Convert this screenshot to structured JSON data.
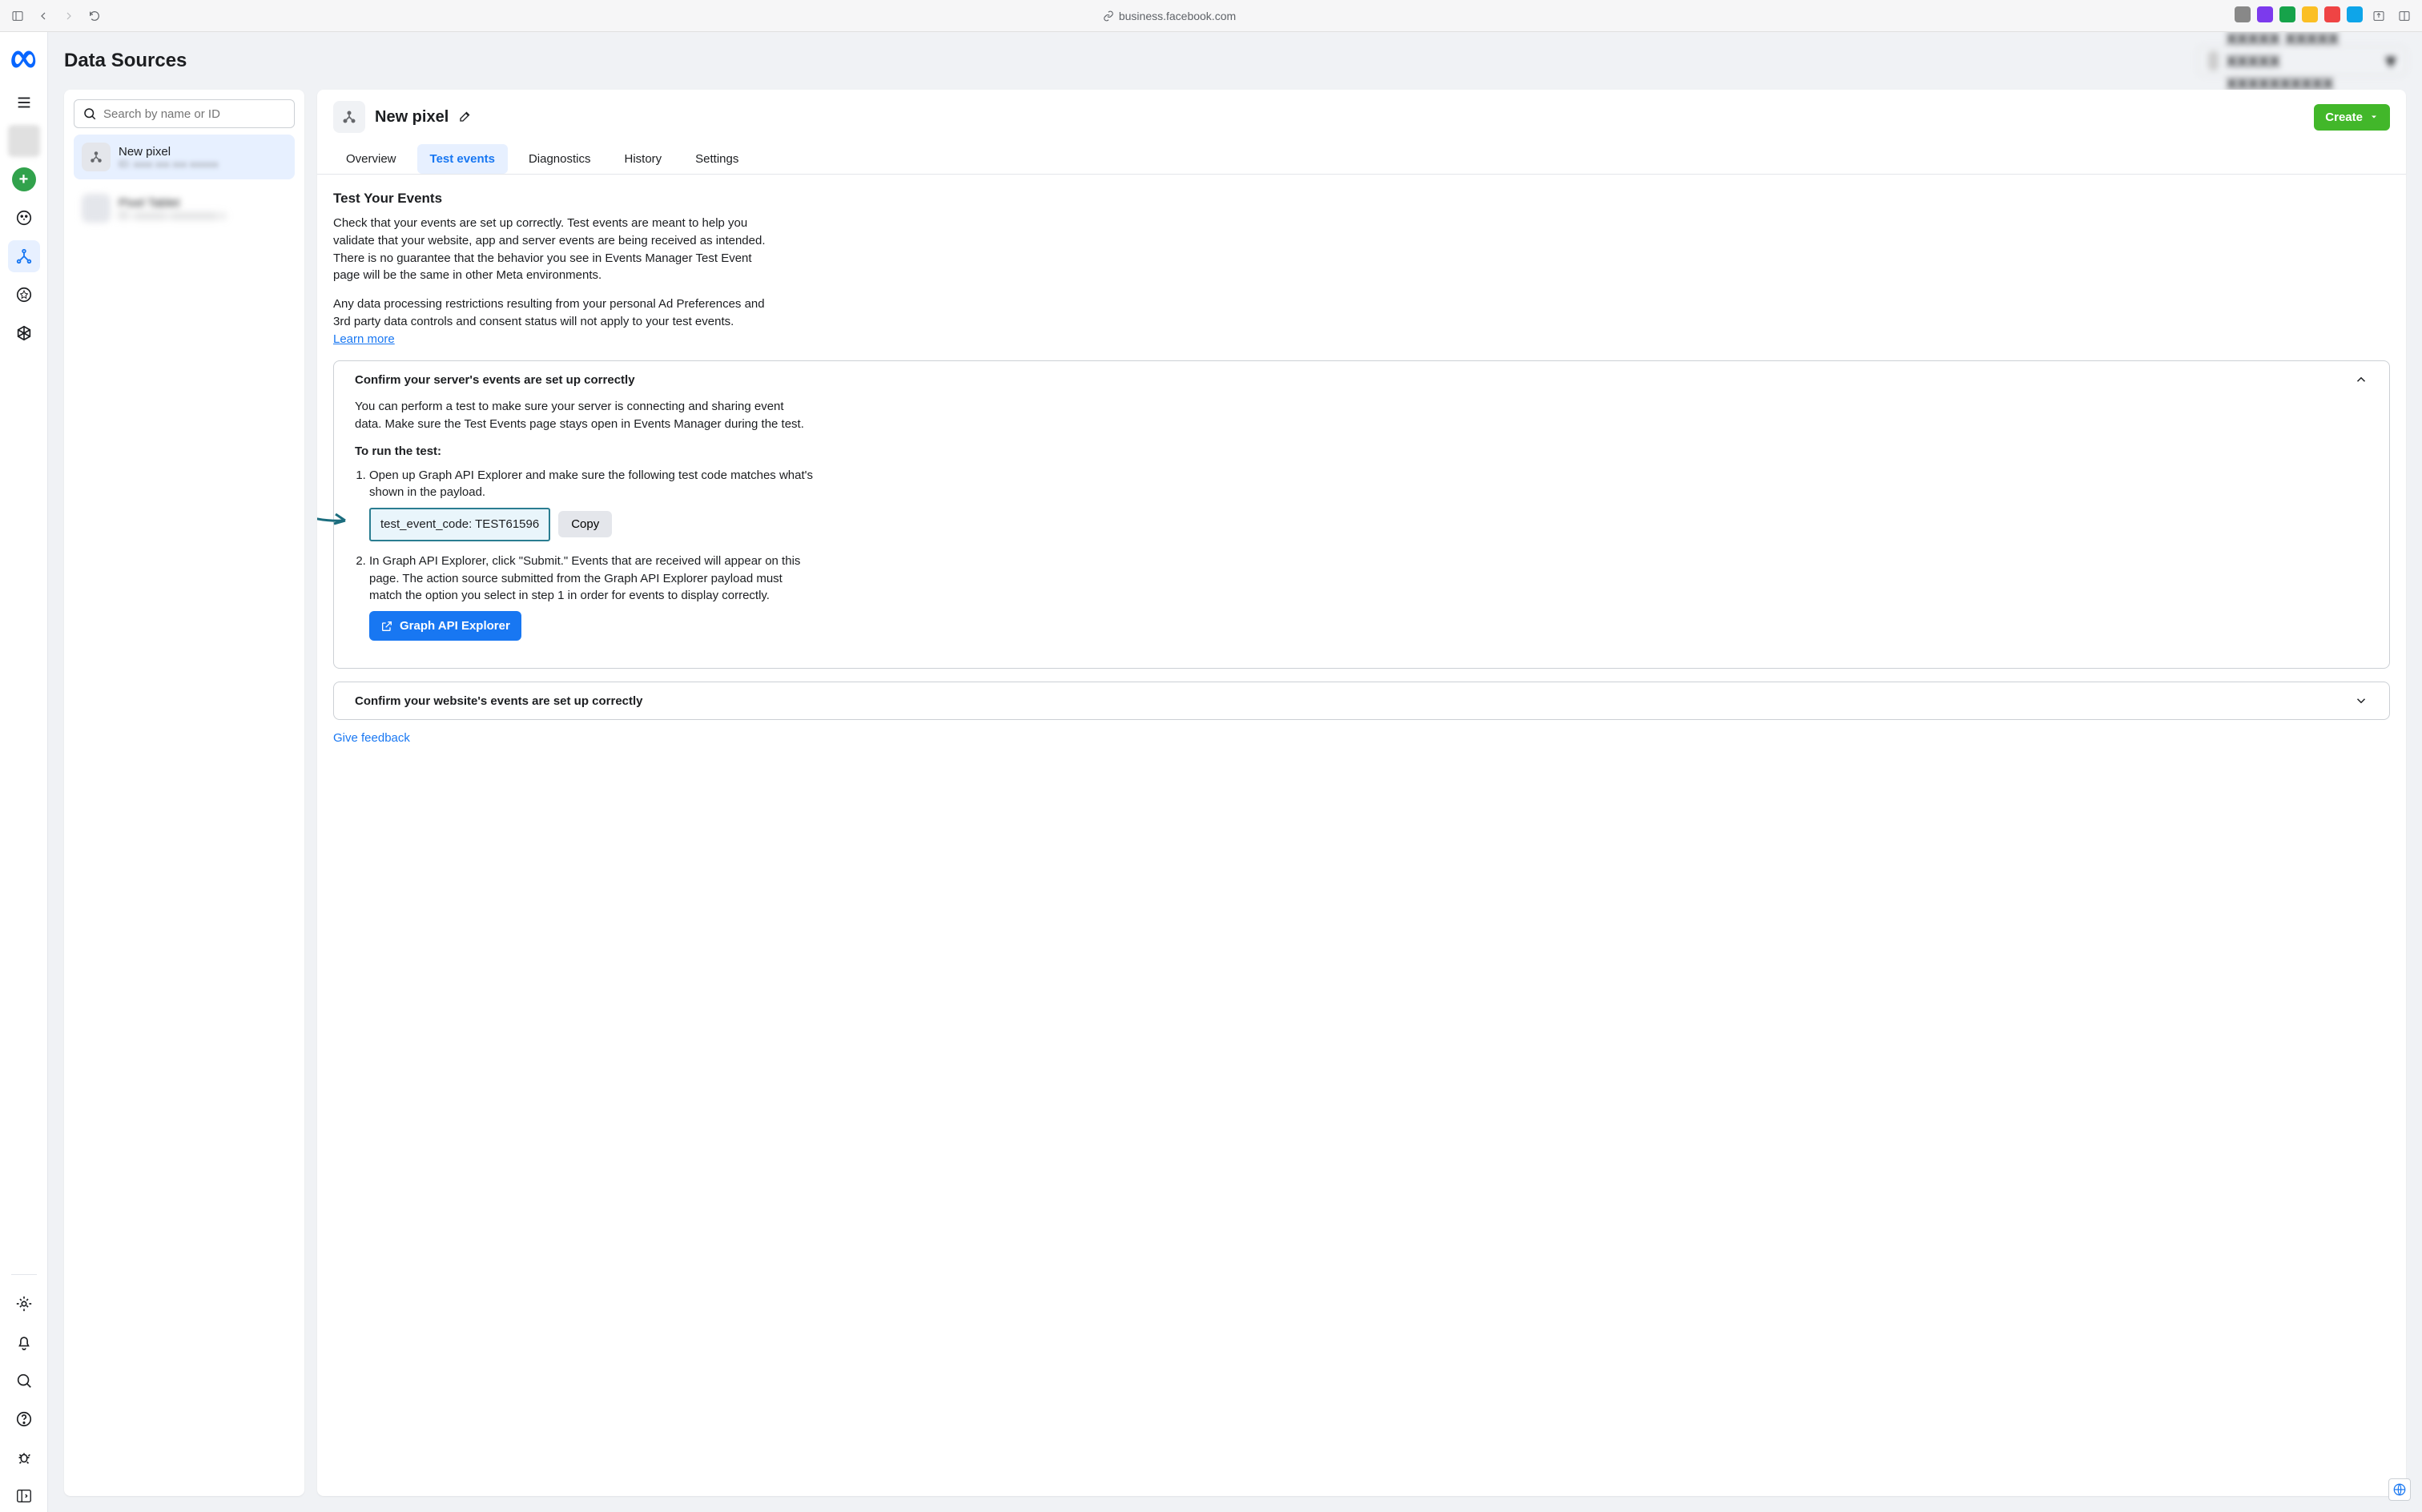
{
  "browser": {
    "url": "business.facebook.com"
  },
  "page_title": "Data Sources",
  "search": {
    "placeholder": "Search by name or ID"
  },
  "sidebar": {
    "items": [
      {
        "name": "New pixel",
        "id": "ID: xxxx xxx xxx xxxxxx"
      },
      {
        "name": "Pixel Tablet",
        "id": "ID: xxxxxxx xxxxxxxxxx x"
      }
    ]
  },
  "header": {
    "title": "New pixel",
    "create_label": "Create"
  },
  "tabs": [
    "Overview",
    "Test events",
    "Diagnostics",
    "History",
    "Settings"
  ],
  "test_events": {
    "title": "Test Your Events",
    "p1": "Check that your events are set up correctly. Test events are meant to help you validate that your website, app and server events are being received as intended. There is no guarantee that the behavior you see in Events Manager Test Event page will be the same in other Meta environments.",
    "p2": "Any data processing restrictions resulting from your personal Ad Preferences and 3rd party data controls and consent status will not apply to your test events.",
    "learn_more": "Learn more"
  },
  "card1": {
    "heading": "Confirm your server's events are set up correctly",
    "intro": "You can perform a test to make sure your server is connecting and sharing event data. Make sure the Test Events page stays open in Events Manager during the test.",
    "run_heading": "To run the test:",
    "step1": "Open up Graph API Explorer and make sure the following test code matches what's shown in the payload.",
    "code": "test_event_code: TEST61596",
    "copy": "Copy",
    "step2": "In Graph API Explorer, click \"Submit.\" Events that are received will appear on this page. The action source submitted from the Graph API Explorer payload must match the option you select in step 1 in order for events to display correctly.",
    "graph_btn": "Graph API Explorer"
  },
  "card2": {
    "heading": "Confirm your website's events are set up correctly"
  },
  "feedback": "Give feedback"
}
